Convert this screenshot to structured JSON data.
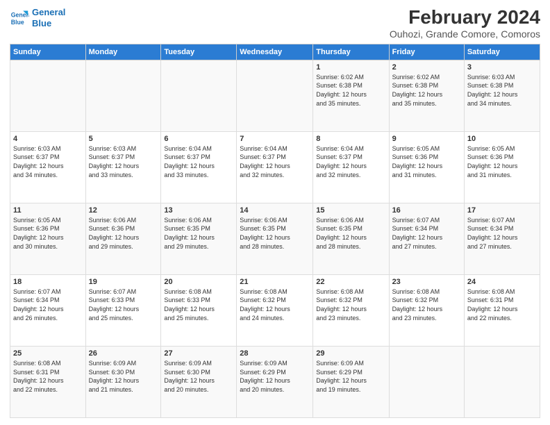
{
  "logo": {
    "line1": "General",
    "line2": "Blue"
  },
  "title": "February 2024",
  "subtitle": "Ouhozi, Grande Comore, Comoros",
  "headers": [
    "Sunday",
    "Monday",
    "Tuesday",
    "Wednesday",
    "Thursday",
    "Friday",
    "Saturday"
  ],
  "weeks": [
    [
      {
        "num": "",
        "info": ""
      },
      {
        "num": "",
        "info": ""
      },
      {
        "num": "",
        "info": ""
      },
      {
        "num": "",
        "info": ""
      },
      {
        "num": "1",
        "info": "Sunrise: 6:02 AM\nSunset: 6:38 PM\nDaylight: 12 hours\nand 35 minutes."
      },
      {
        "num": "2",
        "info": "Sunrise: 6:02 AM\nSunset: 6:38 PM\nDaylight: 12 hours\nand 35 minutes."
      },
      {
        "num": "3",
        "info": "Sunrise: 6:03 AM\nSunset: 6:38 PM\nDaylight: 12 hours\nand 34 minutes."
      }
    ],
    [
      {
        "num": "4",
        "info": "Sunrise: 6:03 AM\nSunset: 6:37 PM\nDaylight: 12 hours\nand 34 minutes."
      },
      {
        "num": "5",
        "info": "Sunrise: 6:03 AM\nSunset: 6:37 PM\nDaylight: 12 hours\nand 33 minutes."
      },
      {
        "num": "6",
        "info": "Sunrise: 6:04 AM\nSunset: 6:37 PM\nDaylight: 12 hours\nand 33 minutes."
      },
      {
        "num": "7",
        "info": "Sunrise: 6:04 AM\nSunset: 6:37 PM\nDaylight: 12 hours\nand 32 minutes."
      },
      {
        "num": "8",
        "info": "Sunrise: 6:04 AM\nSunset: 6:37 PM\nDaylight: 12 hours\nand 32 minutes."
      },
      {
        "num": "9",
        "info": "Sunrise: 6:05 AM\nSunset: 6:36 PM\nDaylight: 12 hours\nand 31 minutes."
      },
      {
        "num": "10",
        "info": "Sunrise: 6:05 AM\nSunset: 6:36 PM\nDaylight: 12 hours\nand 31 minutes."
      }
    ],
    [
      {
        "num": "11",
        "info": "Sunrise: 6:05 AM\nSunset: 6:36 PM\nDaylight: 12 hours\nand 30 minutes."
      },
      {
        "num": "12",
        "info": "Sunrise: 6:06 AM\nSunset: 6:36 PM\nDaylight: 12 hours\nand 29 minutes."
      },
      {
        "num": "13",
        "info": "Sunrise: 6:06 AM\nSunset: 6:35 PM\nDaylight: 12 hours\nand 29 minutes."
      },
      {
        "num": "14",
        "info": "Sunrise: 6:06 AM\nSunset: 6:35 PM\nDaylight: 12 hours\nand 28 minutes."
      },
      {
        "num": "15",
        "info": "Sunrise: 6:06 AM\nSunset: 6:35 PM\nDaylight: 12 hours\nand 28 minutes."
      },
      {
        "num": "16",
        "info": "Sunrise: 6:07 AM\nSunset: 6:34 PM\nDaylight: 12 hours\nand 27 minutes."
      },
      {
        "num": "17",
        "info": "Sunrise: 6:07 AM\nSunset: 6:34 PM\nDaylight: 12 hours\nand 27 minutes."
      }
    ],
    [
      {
        "num": "18",
        "info": "Sunrise: 6:07 AM\nSunset: 6:34 PM\nDaylight: 12 hours\nand 26 minutes."
      },
      {
        "num": "19",
        "info": "Sunrise: 6:07 AM\nSunset: 6:33 PM\nDaylight: 12 hours\nand 25 minutes."
      },
      {
        "num": "20",
        "info": "Sunrise: 6:08 AM\nSunset: 6:33 PM\nDaylight: 12 hours\nand 25 minutes."
      },
      {
        "num": "21",
        "info": "Sunrise: 6:08 AM\nSunset: 6:32 PM\nDaylight: 12 hours\nand 24 minutes."
      },
      {
        "num": "22",
        "info": "Sunrise: 6:08 AM\nSunset: 6:32 PM\nDaylight: 12 hours\nand 23 minutes."
      },
      {
        "num": "23",
        "info": "Sunrise: 6:08 AM\nSunset: 6:32 PM\nDaylight: 12 hours\nand 23 minutes."
      },
      {
        "num": "24",
        "info": "Sunrise: 6:08 AM\nSunset: 6:31 PM\nDaylight: 12 hours\nand 22 minutes."
      }
    ],
    [
      {
        "num": "25",
        "info": "Sunrise: 6:08 AM\nSunset: 6:31 PM\nDaylight: 12 hours\nand 22 minutes."
      },
      {
        "num": "26",
        "info": "Sunrise: 6:09 AM\nSunset: 6:30 PM\nDaylight: 12 hours\nand 21 minutes."
      },
      {
        "num": "27",
        "info": "Sunrise: 6:09 AM\nSunset: 6:30 PM\nDaylight: 12 hours\nand 20 minutes."
      },
      {
        "num": "28",
        "info": "Sunrise: 6:09 AM\nSunset: 6:29 PM\nDaylight: 12 hours\nand 20 minutes."
      },
      {
        "num": "29",
        "info": "Sunrise: 6:09 AM\nSunset: 6:29 PM\nDaylight: 12 hours\nand 19 minutes."
      },
      {
        "num": "",
        "info": ""
      },
      {
        "num": "",
        "info": ""
      }
    ]
  ]
}
